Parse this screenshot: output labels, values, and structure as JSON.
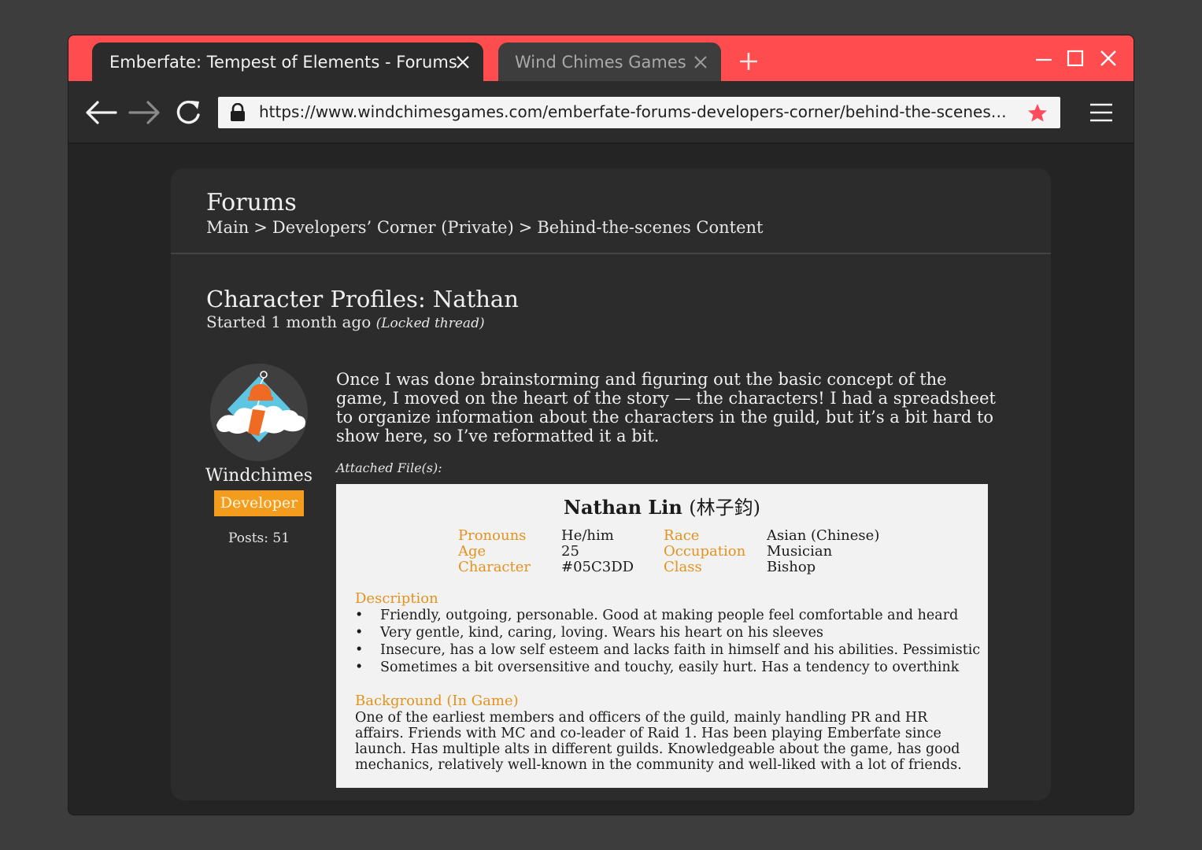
{
  "browser": {
    "tabs": [
      {
        "label": "Emberfate: Tempest of Elements - Forums",
        "active": true
      },
      {
        "label": "Wind Chimes Games",
        "active": false
      }
    ],
    "url": "https://www.windchimesgames.com/emberfate-forums-developers-corner/behind-the-scenes…",
    "accent_color": "#ff4c4f"
  },
  "forum": {
    "title": "Forums",
    "breadcrumb": [
      "Main",
      "Developers’ Corner (Private)",
      "Behind-the-scenes Content"
    ],
    "separator": ">"
  },
  "thread": {
    "title": "Character Profiles: Nathan",
    "started": "Started 1 month ago",
    "status": "(Locked thread)"
  },
  "author": {
    "username": "Windchimes",
    "role": "Developer",
    "posts": "Posts: 51",
    "role_color": "#f39c1e"
  },
  "post": {
    "body": "Once I was done brainstorming and figuring out the basic concept of the game, I moved on the heart of the story — the characters! I had a spreadsheet to organize information about the characters in the guild, but it’s a bit hard to show here, so I’ve reformatted it a bit.",
    "attachments_label": "Attached File(s):"
  },
  "profile": {
    "name": "Nathan Lin",
    "name_cjk": "(林子鈞)",
    "left_fields": [
      {
        "label": "Pronouns",
        "value": "He/him"
      },
      {
        "label": "Age",
        "value": "25"
      },
      {
        "label": "Character",
        "value": "#05C3DD"
      }
    ],
    "right_fields": [
      {
        "label": "Race",
        "value": "Asian (Chinese)"
      },
      {
        "label": "Occupation",
        "value": "Musician"
      },
      {
        "label": "Class",
        "value": "Bishop"
      }
    ],
    "description_heading": "Description",
    "description": [
      "Friendly, outgoing, personable. Good at making people feel comfortable and heard",
      "Very gentle, kind, caring, loving. Wears his heart on his sleeves",
      "Insecure, has a low self esteem and lacks faith in himself and his abilities. Pessimistic",
      "Sometimes a bit oversensitive and touchy, easily hurt. Has a tendency to overthink"
    ],
    "background_heading": "Background (In Game)",
    "background": "One of the earliest members and officers of the guild, mainly handling PR and HR affairs. Friends with MC and co-leader of Raid 1. Has been playing Emberfate since launch. Has multiple alts in different guilds. Knowledgeable about the game, has good mechanics, relatively well-known in the community and well-liked with a lot of friends.",
    "label_color": "#e3921d"
  }
}
